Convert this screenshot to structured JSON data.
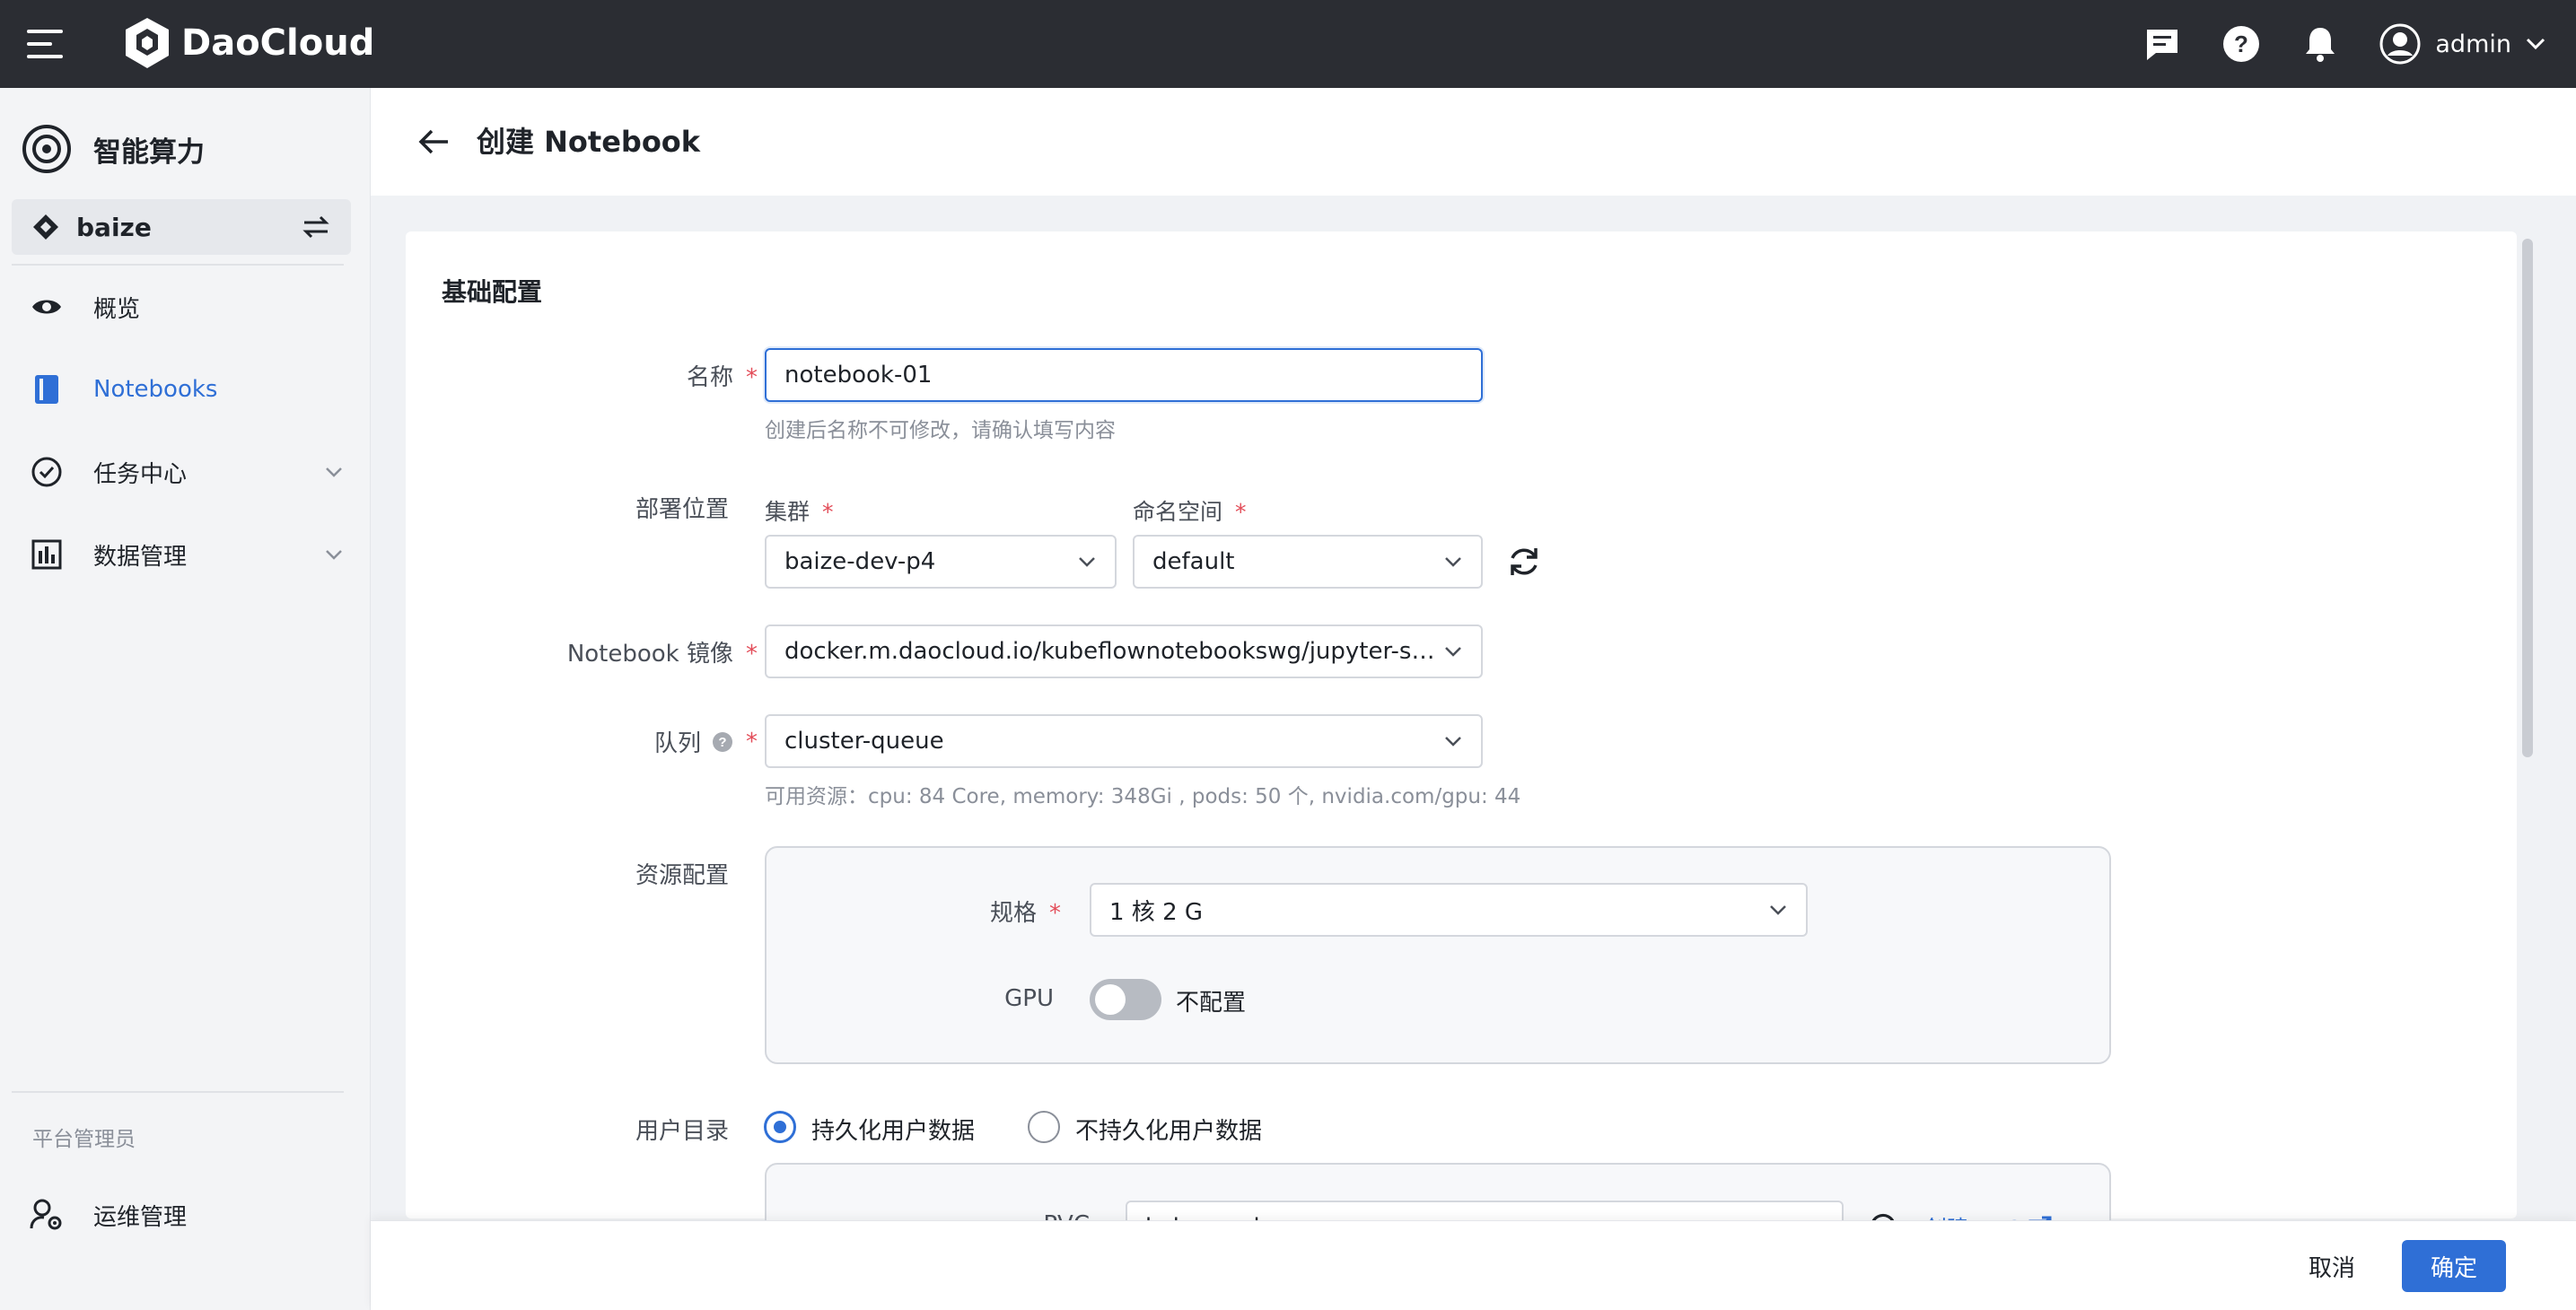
{
  "topbar": {
    "brand": "DaoCloud",
    "user_name": "admin",
    "icons": [
      "menu-icon",
      "message-icon",
      "help-icon",
      "bell-icon",
      "user-avatar-icon",
      "chevron-down-icon"
    ]
  },
  "sidebar": {
    "module_title": "智能算力",
    "workspace": "baize",
    "items": [
      {
        "label": "概览",
        "icon": "eye-icon"
      },
      {
        "label": "Notebooks",
        "icon": "notebook-icon"
      },
      {
        "label": "任务中心",
        "icon": "task-check-icon"
      },
      {
        "label": "数据管理",
        "icon": "data-chart-icon"
      }
    ],
    "section_label": "平台管理员",
    "ops_item": "运维管理"
  },
  "header": {
    "title": "创建 Notebook"
  },
  "form": {
    "section_title": "基础配置",
    "name": {
      "label": "名称",
      "value": "notebook-01",
      "help": "创建后名称不可修改，请确认填写内容"
    },
    "deploy": {
      "label": "部署位置",
      "cluster_label": "集群",
      "cluster_value": "baize-dev-p4",
      "namespace_label": "命名空间",
      "namespace_value": "default"
    },
    "image": {
      "label": "Notebook 镜像",
      "value": "docker.m.daocloud.io/kubeflownotebookswg/jupyter-scipy:v..."
    },
    "queue": {
      "label": "队列",
      "value": "cluster-queue",
      "help": "可用资源：cpu: 84 Core, memory: 348Gi , pods: 50 个, nvidia.com/gpu: 44"
    },
    "resource": {
      "label": "资源配置",
      "spec_label": "规格",
      "spec_value": "1 核 2 G",
      "gpu_label": "GPU",
      "gpu_toggle_text": "不配置",
      "gpu_enabled": false
    },
    "user_dir": {
      "label": "用户目录",
      "option_persist": "持久化用户数据",
      "option_no_persist": "不持久化用户数据",
      "selected": "持久化用户数据",
      "pvc_label": "PVC",
      "pvc_value": "kube-workspace",
      "create_pvc_link": "创建 PVC"
    }
  },
  "footer": {
    "cancel_label": "取消",
    "ok_label": "确定"
  },
  "colors": {
    "topbar_bg": "#2b2d33",
    "accent": "#2f6fd6",
    "required": "#e34d59"
  }
}
